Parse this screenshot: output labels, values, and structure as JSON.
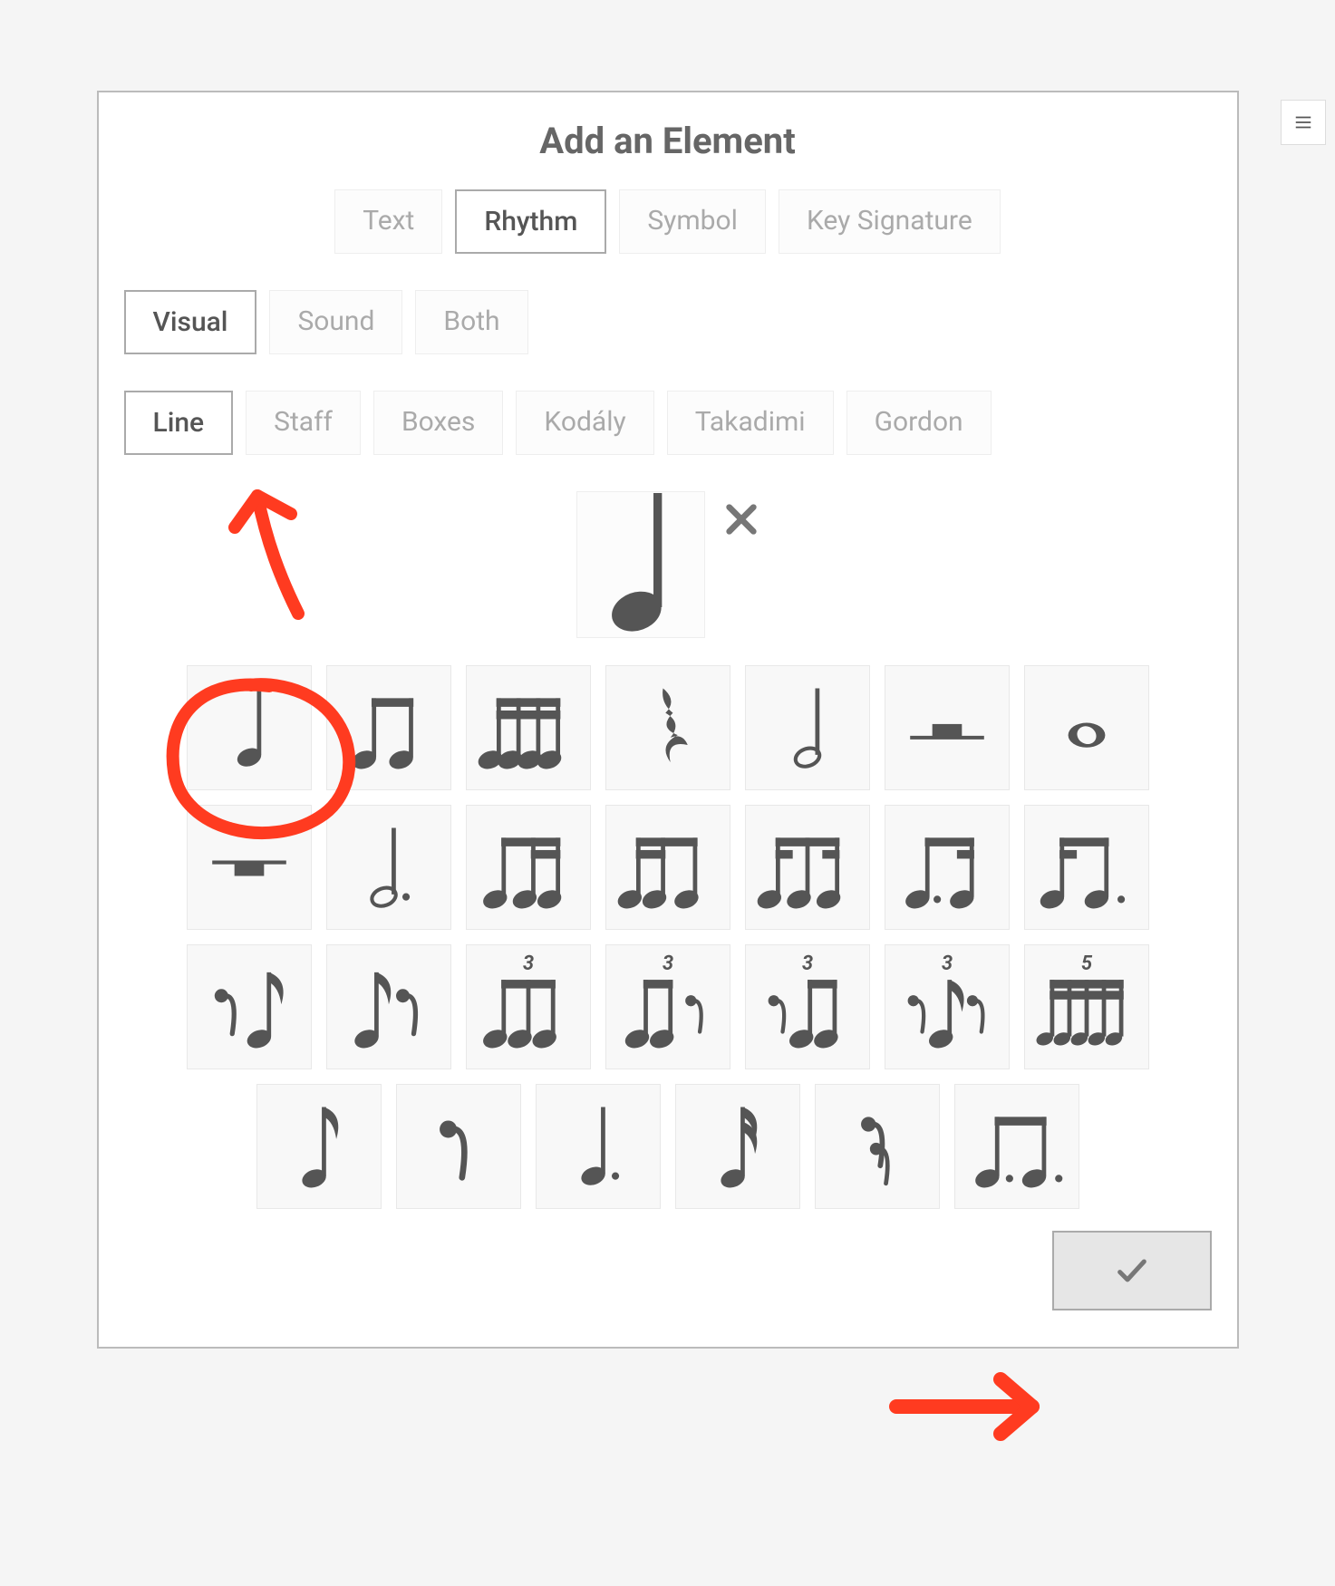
{
  "dialog": {
    "title": "Add an Element"
  },
  "tabs": {
    "type": {
      "options": [
        "Text",
        "Rhythm",
        "Symbol",
        "Key Signature"
      ],
      "selected": 1
    },
    "mode": {
      "options": [
        "Visual",
        "Sound",
        "Both"
      ],
      "selected": 0
    },
    "style": {
      "options": [
        "Line",
        "Staff",
        "Boxes",
        "Kodály",
        "Takadimi",
        "Gordon"
      ],
      "selected": 0
    }
  },
  "preview": {
    "current": "quarter-note",
    "clear_label": "✕"
  },
  "palette": [
    {
      "id": "quarter-note",
      "label": "Quarter note"
    },
    {
      "id": "eighth-pair",
      "label": "Two eighths"
    },
    {
      "id": "sixteenth-four",
      "label": "Four sixteenths"
    },
    {
      "id": "quarter-rest",
      "label": "Quarter rest"
    },
    {
      "id": "half-note",
      "label": "Half note"
    },
    {
      "id": "half-rest",
      "label": "Half rest"
    },
    {
      "id": "whole-note",
      "label": "Whole note"
    },
    {
      "id": "whole-rest",
      "label": "Whole rest"
    },
    {
      "id": "dotted-half",
      "label": "Dotted half"
    },
    {
      "id": "eighth-sixteenth-two",
      "label": "Eighth + two sixteenths"
    },
    {
      "id": "two-sixteenth-eighth",
      "label": "Two sixteenths + eighth"
    },
    {
      "id": "synco-sixteenth",
      "label": "Sixteenth-eighth-sixteenth"
    },
    {
      "id": "dotted8-16",
      "label": "Dotted eighth + sixteenth"
    },
    {
      "id": "sixteenth-dotted8",
      "label": "Sixteenth + dotted eighth"
    },
    {
      "id": "eighth-rest-eighth",
      "label": "Eighth rest + eighth"
    },
    {
      "id": "eighth-eighth-rest",
      "label": "Eighth + eighth rest"
    },
    {
      "id": "triplet-eighths",
      "label": "Triplet eighths",
      "tuplet": "3"
    },
    {
      "id": "triplet-2eighth-rest",
      "label": "Triplet 2 eighths + rest",
      "tuplet": "3"
    },
    {
      "id": "triplet-rest-2eighth",
      "label": "Triplet rest + 2 eighths",
      "tuplet": "3"
    },
    {
      "id": "triplet-rest-eighth-rest",
      "label": "Triplet rest-eighth-rest",
      "tuplet": "3"
    },
    {
      "id": "quintuplet-16",
      "label": "Quintuplet sixteenths",
      "tuplet": "5"
    },
    {
      "id": "single-eighth",
      "label": "Eighth note"
    },
    {
      "id": "eighth-rest",
      "label": "Eighth rest"
    },
    {
      "id": "dotted-quarter",
      "label": "Dotted quarter"
    },
    {
      "id": "single-sixteenth",
      "label": "Sixteenth"
    },
    {
      "id": "sixteenth-rest",
      "label": "Sixteenth rest"
    },
    {
      "id": "dotted8-dot-eighth",
      "label": "Dotted eighth + dotted eighth"
    }
  ],
  "confirm_label": "OK",
  "annotations": {
    "circle_cell_index": 0,
    "arrow_to_style_tab": true,
    "arrow_to_confirm": true
  }
}
